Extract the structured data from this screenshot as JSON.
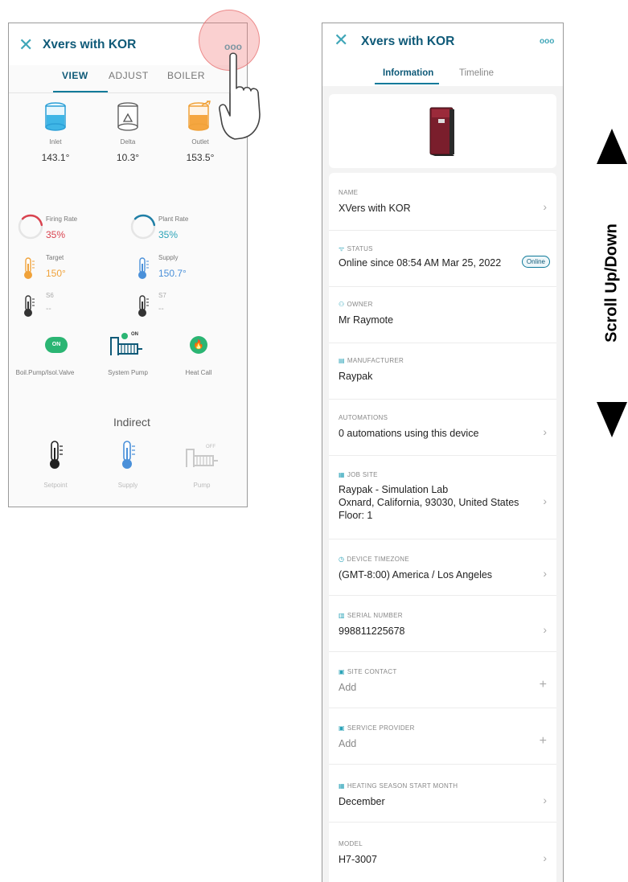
{
  "left": {
    "title": "Xvers with KOR",
    "more": "ooo",
    "tabs": [
      "VIEW",
      "ADJUST",
      "BOILER"
    ],
    "temps": [
      {
        "label": "Inlet",
        "value": "143.1°"
      },
      {
        "label": "Delta",
        "value": "10.3°"
      },
      {
        "label": "Outlet",
        "value": "153.5°"
      }
    ],
    "firing": {
      "label": "Firing Rate",
      "value": "35%",
      "fraction": 0.35
    },
    "plant": {
      "label": "Plant Rate",
      "value": "35%",
      "fraction": 0.35
    },
    "target": {
      "label": "Target",
      "value": "150°"
    },
    "supply": {
      "label": "Supply",
      "value": "150.7°"
    },
    "s6": {
      "label": "S6",
      "value": "--"
    },
    "s7": {
      "label": "S7",
      "value": "--"
    },
    "pumps": [
      {
        "label": "Boil.Pump/Isol.Valve",
        "state": "ON"
      },
      {
        "label": "System Pump",
        "state": "ON"
      },
      {
        "label": "Heat Call",
        "state": ""
      }
    ],
    "indirect": {
      "title": "Indirect",
      "items": [
        {
          "label": "Setpoint"
        },
        {
          "label": "Supply"
        },
        {
          "label": "Pump",
          "state": "OFF"
        }
      ]
    }
  },
  "right": {
    "title": "Xvers with KOR",
    "more": "ooo",
    "tabs": [
      "Information",
      "Timeline"
    ],
    "fields": {
      "name": {
        "label": "NAME",
        "value": "XVers with KOR"
      },
      "status": {
        "label": "STATUS",
        "value": "Online since 08:54 AM Mar 25, 2022",
        "badge": "Online"
      },
      "owner": {
        "label": "OWNER",
        "value": "Mr Raymote"
      },
      "manufacturer": {
        "label": "MANUFACTURER",
        "value": "Raypak"
      },
      "automations": {
        "label": "AUTOMATIONS",
        "value": "0 automations using this device"
      },
      "job_site": {
        "label": "JOB SITE",
        "line1": "Raypak - Simulation Lab",
        "line2": "Oxnard, California, 93030, United States",
        "line3": "Floor: 1"
      },
      "timezone": {
        "label": "DEVICE TIMEZONE",
        "value": "(GMT-8:00) America / Los Angeles"
      },
      "serial": {
        "label": "SERIAL NUMBER",
        "value": "998811225678"
      },
      "site_contact": {
        "label": "SITE CONTACT",
        "value": "Add"
      },
      "service_provider": {
        "label": "SERVICE PROVIDER",
        "value": "Add"
      },
      "heating": {
        "label": "HEATING SEASON START MONTH",
        "value": "December"
      },
      "model": {
        "label": "MODEL",
        "value": "H7-3007"
      }
    }
  },
  "scroll_label": "Scroll Up/Down",
  "colors": {
    "accent": "#0f5a78",
    "teal": "#3fa6b8",
    "green": "#2bb573",
    "red": "#d9434f",
    "orange": "#f0a23a",
    "blue": "#4a90d9"
  }
}
